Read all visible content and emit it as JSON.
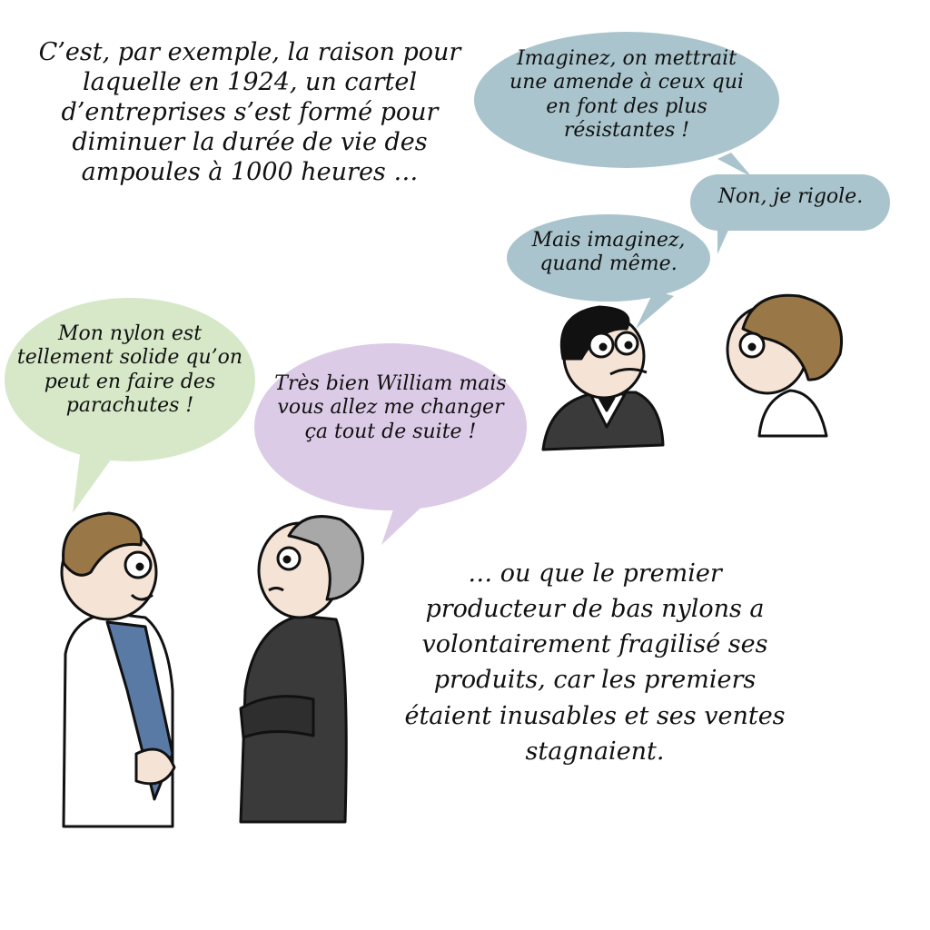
{
  "captions": {
    "intro": "C’est, par exemple, la raison pour laquelle en 1924, un cartel d’entreprises s’est formé pour diminuer la durée de vie des ampoules à 1000 heures …",
    "nylon": "… ou que le premier producteur de bas nylons a volontairement fragilisé ses produits, car les premiers étaient inusables et ses ventes stagnaient."
  },
  "bubbles": {
    "amende": "Imaginez, on mettrait une amende à ceux qui en font des plus résistantes !",
    "rigole": "Non, je rigole.",
    "imaginez": "Mais imaginez, quand même.",
    "nylon_solide": "Mon nylon est tellement solide qu’on peut en faire des parachutes !",
    "william": "Très bien William mais vous allez me changer ça tout de suite !"
  },
  "colors": {
    "blue_bubble": "#a9c4cc",
    "green_bubble": "#d6e8c8",
    "purple_bubble": "#dccbe6",
    "skin": "#f5e4d6",
    "brown_hair": "#9a7747",
    "grey_hair": "#a8a8a8",
    "dark_suit": "#3a3a3a",
    "blue_shirt": "#5a7aa6"
  }
}
